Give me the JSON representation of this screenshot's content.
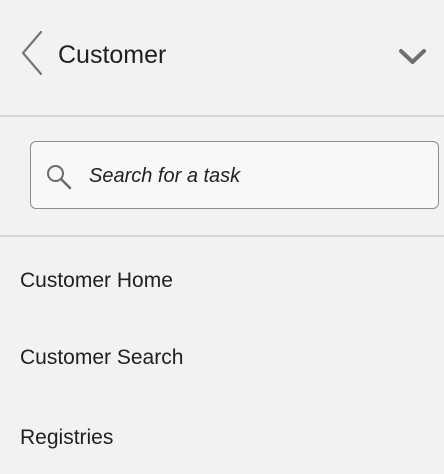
{
  "header": {
    "title": "Customer",
    "back_icon": "chevron-left-icon",
    "collapse_icon": "chevron-down-icon"
  },
  "search": {
    "placeholder": "Search for a task",
    "value": "",
    "icon": "search-icon"
  },
  "nav": {
    "items": [
      {
        "label": "Customer Home"
      },
      {
        "label": "Customer Search"
      },
      {
        "label": "Registries"
      }
    ]
  },
  "colors": {
    "background": "#f2f2f2",
    "divider": "#d6d6d6",
    "border": "#8d8d8d",
    "text": "#202020",
    "icon": "#6b6b6b"
  }
}
